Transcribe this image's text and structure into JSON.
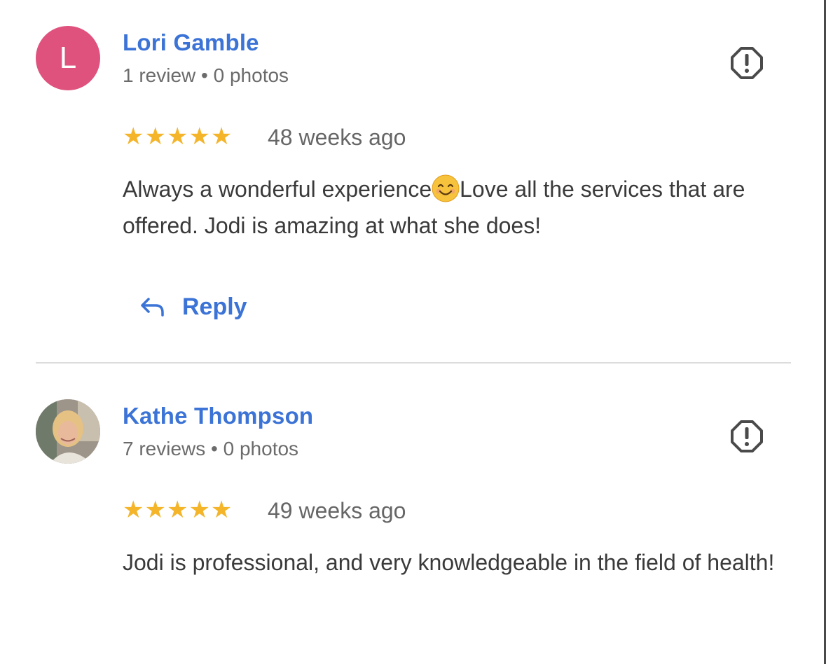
{
  "reviews": [
    {
      "reviewer_name": "Lori Gamble",
      "avatar_letter": "L",
      "stats": "1 review • 0 photos",
      "stars": "★★★★★",
      "rating": 5,
      "time_ago": "48 weeks ago",
      "text_before_emoji": "Always a wonderful experience",
      "emoji": "smiling-face-icon",
      "text_after_emoji": "Love all the services that are offered. Jodi is amazing at what she does!",
      "reply_label": "Reply"
    },
    {
      "reviewer_name": "Kathe Thompson",
      "stats": "7 reviews • 0 photos",
      "stars": "★★★★★",
      "rating": 5,
      "time_ago": "49 weeks ago",
      "text": "Jodi is professional, and very knowledgeable in the field of health!"
    }
  ],
  "colors": {
    "name_link": "#3b73d6",
    "star": "#f4b52a",
    "avatar_letter_bg": "#e0527e"
  }
}
